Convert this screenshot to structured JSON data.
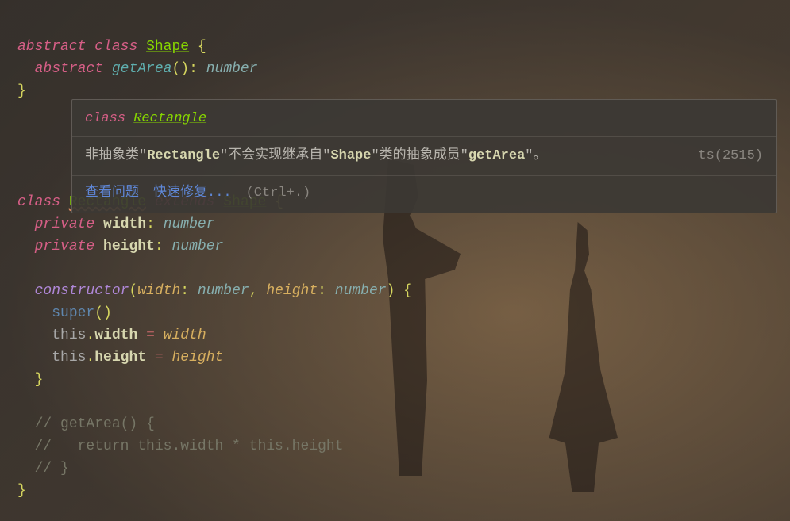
{
  "code": {
    "abstract": "abstract",
    "class": "class",
    "shape": "Shape",
    "getArea": "getArea",
    "number": "number",
    "rectangle": "Rectangle",
    "extends": "extends",
    "private": "private",
    "width": "width",
    "height": "height",
    "constructor": "constructor",
    "super": "super",
    "this": "this",
    "comment1": "// getArea() {",
    "comment2": "//   return this.width * this.height",
    "comment3": "// }"
  },
  "popup": {
    "class": "class",
    "rectangle": "Rectangle",
    "msg_p1": "非抽象类",
    "msg_q1": "\"",
    "msg_rect": "Rectangle",
    "msg_q2": "\"",
    "msg_p2": "不会实现继承自",
    "msg_q3": "\"",
    "msg_shape": "Shape",
    "msg_q4": "\"",
    "msg_p3": "类的抽象成员",
    "msg_q5": "\"",
    "msg_getarea": "getArea",
    "msg_q6": "\"",
    "msg_p4": "。",
    "ts_code": "ts(2515)",
    "link_view": "查看问题",
    "link_fix": "快速修复...",
    "shortcut": "(Ctrl+.)"
  }
}
